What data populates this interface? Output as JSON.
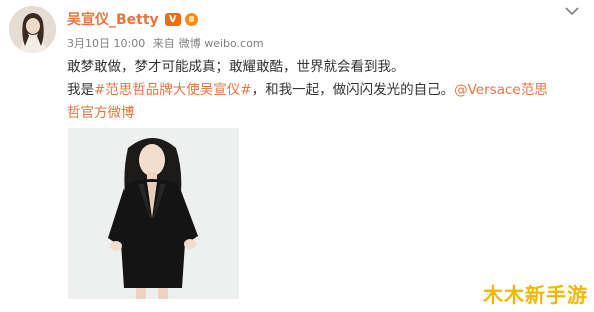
{
  "post": {
    "username": "吴宣仪_Betty",
    "vip_badge": "V",
    "date": "3月10日 10:00",
    "source_prefix": "来自",
    "source": "微博 weibo.com",
    "text_line1": "敢梦敢做，梦才可能成真；敢耀敢酷，世界就会看到我。",
    "line2_prefix": "我是",
    "hashtag": "#范思哲品牌大使吴宣仪#",
    "line2_middle": "，和我一起，做闪闪发光的自己。",
    "mention_part1": "@Versace范思",
    "mention_part2": "哲官方微博"
  },
  "watermark": {
    "text": "木木新手游"
  },
  "colors": {
    "link": "#eb7340",
    "username": "#eb7340",
    "meta": "#808080",
    "watermark": "#f2b705"
  },
  "icons": {
    "chevron": "chevron-down-icon",
    "vip": "vip-badge-icon",
    "level": "level-badge-icon"
  }
}
